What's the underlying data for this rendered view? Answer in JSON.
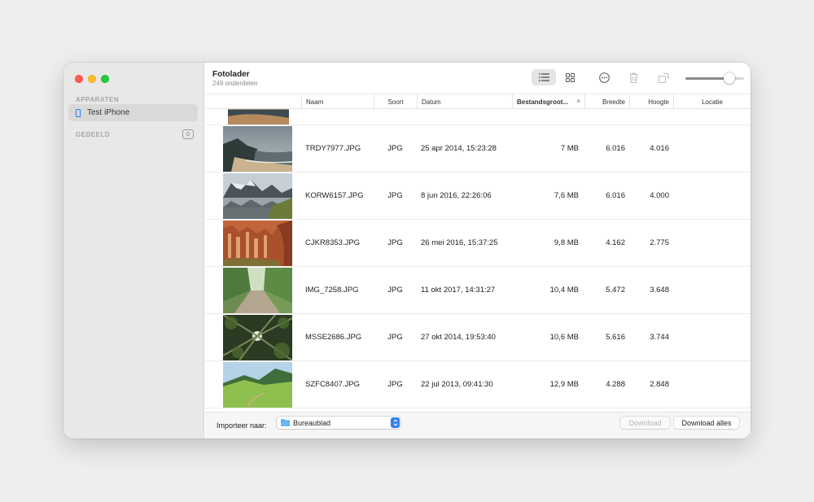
{
  "window": {
    "title": "Fotolader",
    "subtitle": "249 onderdelen"
  },
  "sidebar": {
    "section_devices": "APPARATEN",
    "device_name": "Test iPhone",
    "section_shared": "GEDEELD",
    "shared_count": "0"
  },
  "toolbar": {
    "icons": [
      "list-view-icon",
      "grid-view-icon",
      "more-icon",
      "trash-icon",
      "rotate-icon"
    ],
    "zoom_level": 0.75
  },
  "columns": {
    "name": "Naam",
    "kind": "Soort",
    "date": "Datum",
    "size": "Bestandsgroot...",
    "width": "Breedte",
    "height": "Hoogte",
    "location": "Locatie",
    "sort_indicator": "^"
  },
  "rows": [
    {
      "name": "TRDY7977.JPG",
      "kind": "JPG",
      "date": "25 apr 2014, 15:23:28",
      "size": "7 MB",
      "width": "6.016",
      "height": "4.016",
      "location": ""
    },
    {
      "name": "KORW6157.JPG",
      "kind": "JPG",
      "date": "8 jun 2016, 22:26:06",
      "size": "7,6 MB",
      "width": "6.016",
      "height": "4.000",
      "location": ""
    },
    {
      "name": "CJKR8353.JPG",
      "kind": "JPG",
      "date": "26 mei 2016, 15:37:25",
      "size": "9,8 MB",
      "width": "4.162",
      "height": "2.775",
      "location": ""
    },
    {
      "name": "IMG_7258.JPG",
      "kind": "JPG",
      "date": "11 okt 2017, 14:31:27",
      "size": "10,4 MB",
      "width": "5.472",
      "height": "3.648",
      "location": ""
    },
    {
      "name": "MSSE2686.JPG",
      "kind": "JPG",
      "date": "27 okt 2014, 19:53:40",
      "size": "10,6 MB",
      "width": "5.616",
      "height": "3.744",
      "location": ""
    },
    {
      "name": "SZFC8407.JPG",
      "kind": "JPG",
      "date": "22 jul 2013, 09:41:30",
      "size": "12,9 MB",
      "width": "4.288",
      "height": "2.848",
      "location": ""
    }
  ],
  "bottom": {
    "import_label": "Importeer naar:",
    "destination": "Bureaublad",
    "download": "Download",
    "download_all": "Download alles"
  },
  "colors": {
    "accent": "#2f7ef6",
    "close": "#fe5f57",
    "minimize": "#febc2e",
    "zoom": "#28c840"
  }
}
